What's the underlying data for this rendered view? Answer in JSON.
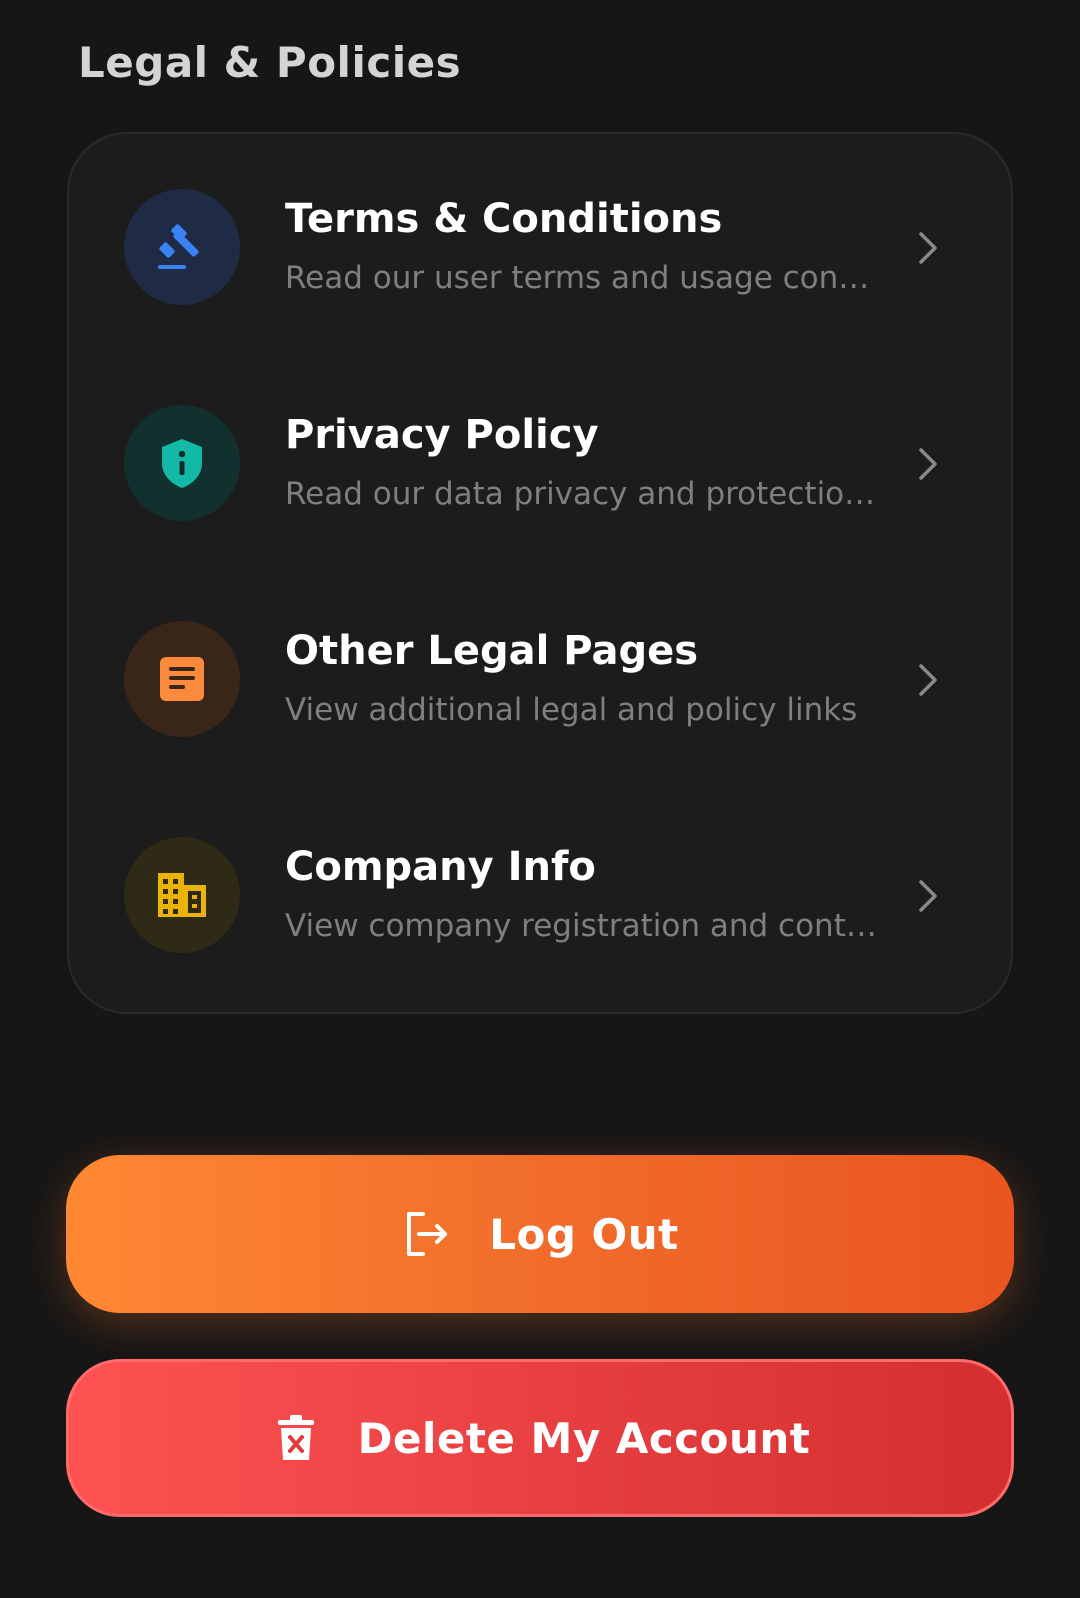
{
  "section": {
    "title": "Legal & Policies"
  },
  "items": [
    {
      "title": "Terms & Conditions",
      "subtitle": "Read our user terms and usage conditions",
      "icon": "gavel-icon",
      "icon_color": "#3b82f6",
      "icon_bg": "#1f2a44"
    },
    {
      "title": "Privacy Policy",
      "subtitle": "Read our data privacy and protection policy",
      "icon": "shield-info-icon",
      "icon_color": "#14b8a6",
      "icon_bg": "#12312e"
    },
    {
      "title": "Other Legal Pages",
      "subtitle": "View additional legal and policy links",
      "icon": "document-icon",
      "icon_color": "#fb8a3c",
      "icon_bg": "#3a2618"
    },
    {
      "title": "Company Info",
      "subtitle": "View company registration and contact details",
      "icon": "building-icon",
      "icon_color": "#eab308",
      "icon_bg": "#2e2a16"
    }
  ],
  "actions": {
    "logout_label": "Log Out",
    "delete_label": "Delete My Account",
    "logout_icon": "logout-icon",
    "delete_icon": "trash-icon"
  },
  "colors": {
    "background": "#161616",
    "card": "#1c1c1c",
    "logout_start": "#ff8833",
    "logout_end": "#ea5520",
    "delete_start": "#ff5252",
    "delete_end": "#d32f2f"
  }
}
